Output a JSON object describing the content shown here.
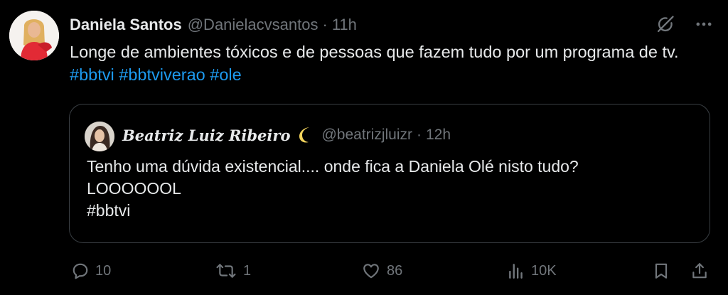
{
  "tweet": {
    "author_name": "Daniela Santos",
    "handle": "@Danielacvsantos",
    "separator": "·",
    "time": "11h",
    "text_prefix": "Longe de ambientes tóxicos e de pessoas que fazem tudo por um programa de tv. ",
    "hashtags": [
      "#bbtvi",
      "#bbtviverao",
      "#ole"
    ]
  },
  "quote": {
    "author_name": "Beatriz Luiz Ribeiro",
    "name_emoji": "crescent-moon-icon",
    "handle": "@beatrizjluizr",
    "separator": "·",
    "time": "12h",
    "lines": [
      "Tenho uma dúvida existencial.... onde fica a Daniela Olé nisto tudo?",
      "LOOOOOOL",
      "#bbtvi"
    ]
  },
  "actions": {
    "replies": "10",
    "reposts": "1",
    "likes": "86",
    "views": "10K"
  },
  "colors": {
    "background": "#000000",
    "text": "#e7e9ea",
    "muted": "#71767b",
    "accent": "#1d9bf0",
    "border": "#3a3f44"
  },
  "icons": {
    "top": [
      "grok-icon",
      "more-icon"
    ],
    "bar": [
      "reply-icon",
      "repost-icon",
      "like-icon",
      "views-icon",
      "bookmark-icon",
      "share-icon"
    ]
  }
}
